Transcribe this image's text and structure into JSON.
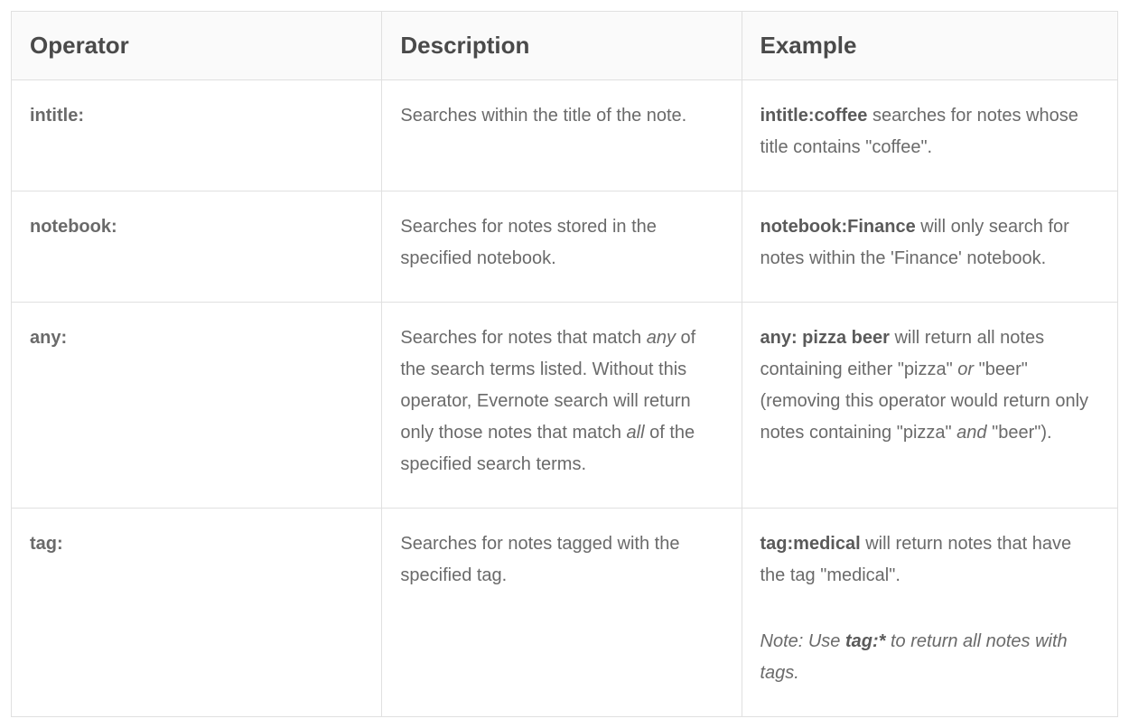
{
  "headers": {
    "operator": "Operator",
    "description": "Description",
    "example": "Example"
  },
  "rows": [
    {
      "operator": "intitle:",
      "description": "Searches within the title of the note.",
      "example_bold1": "intitle:coffee",
      "example_rest": " searches for notes whose title contains \"coffee\"."
    },
    {
      "operator": "notebook:",
      "description": "Searches for notes stored in the specified notebook.",
      "example_bold1": "notebook:Finance",
      "example_rest": " will only search for notes within the 'Finance' notebook."
    },
    {
      "operator": "any:",
      "desc_p1": "Searches for notes that match ",
      "desc_i1": "any",
      "desc_p2": " of the search terms listed. Without this operator, Evernote search will return only those notes that match ",
      "desc_i2": "all",
      "desc_p3": " of the specified search terms.",
      "example_bold1": "any: pizza beer",
      "example_p1": " will return all notes containing either \"pizza\" ",
      "example_i1": "or ",
      "example_p2": "\"beer\" (removing this operator would return only notes containing \"pizza\" ",
      "example_i2": "and ",
      "example_p3": "\"beer\")."
    },
    {
      "operator": "tag:",
      "description": "Searches for notes tagged with the specified tag.",
      "example_bold1": "tag:medical",
      "example_rest": " will return notes that have the tag \"medical\".",
      "note_prefix": "Note: Use ",
      "note_bold": "tag:*",
      "note_suffix": " to return all notes with tags."
    }
  ]
}
